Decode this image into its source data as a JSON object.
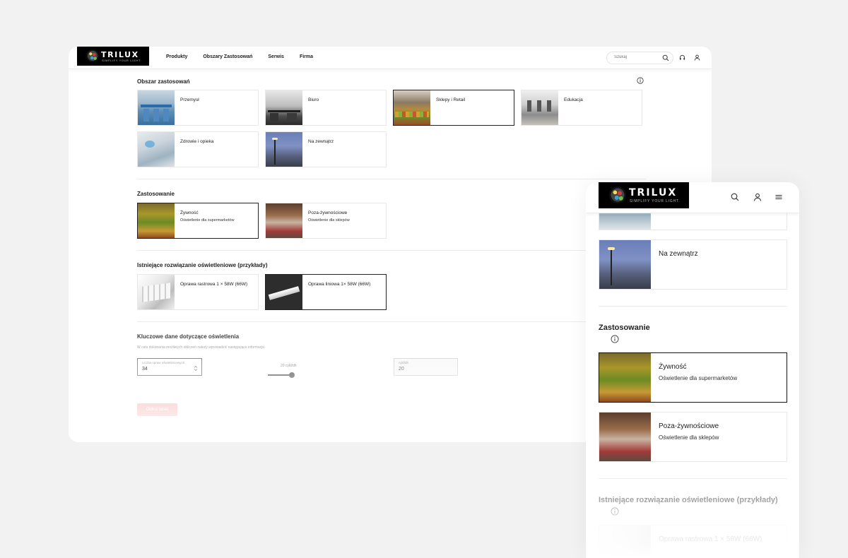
{
  "brand": {
    "name": "TRILUX",
    "tagline": "SIMPLIFY YOUR LIGHT."
  },
  "nav": {
    "items": [
      "Produkty",
      "Obszary Zastosowań",
      "Serwis",
      "Firma"
    ]
  },
  "search": {
    "placeholder": "Szukaj"
  },
  "sections": {
    "areas": {
      "title": "Obszar zastosowań",
      "items": [
        {
          "label": "Przemysł",
          "selected": false
        },
        {
          "label": "Biuro",
          "selected": false
        },
        {
          "label": "Sklepy i Retail",
          "selected": true
        },
        {
          "label": "Edukacja",
          "selected": false
        },
        {
          "label": "Zdrowie i opieka",
          "selected": false
        },
        {
          "label": "Na zewnątrz",
          "selected": false
        }
      ]
    },
    "application": {
      "title": "Zastosowanie",
      "items": [
        {
          "label": "Żywność",
          "sub": "Oświetlenie dla supermarketów",
          "selected": true
        },
        {
          "label": "Poza-żywnościowe",
          "sub": "Oświetlenie dla sklepów",
          "selected": false
        }
      ]
    },
    "existing": {
      "title": "Istniejące rozwiązanie oświetleniowe (przykłady)",
      "items": [
        {
          "label": "Oprawa rastrowa 1 × 58W (66W)",
          "selected": false
        },
        {
          "label": "Oprawa liniowa 1× 58W (66W)",
          "selected": true
        }
      ]
    },
    "keydata": {
      "title": "Kluczowe dane dotyczące oświetlenia",
      "subtitle": "W celu dokonania możliwych obliczeń należy wprowadzić następujące informacje.",
      "fixtures_label": "Liczba opraw oświetleniowych",
      "fixtures_value": "34",
      "slider_label": "20 cykl/dh",
      "slider_fraction": 0.83,
      "hours_label": "cykl/dh",
      "hours_value": "20",
      "button": "Oblicz teraz"
    }
  },
  "mobile": {
    "partial_item": "",
    "outdoor": "Na zewnątrz",
    "application_title": "Zastosowanie",
    "food": {
      "label": "Żywność",
      "sub": "Oświetlenie dla supermarketów"
    },
    "nonfood": {
      "label": "Poza-żywnościowe",
      "sub": "Oświetlenie dla sklepów"
    },
    "existing_title": "Istniejące rozwiązanie oświetleniowe (przykłady)",
    "existing_first": "Oprawa rastrowa 1 × 58W (66W)"
  },
  "colors": {
    "accent": "#f4b7b7",
    "selected_border": "#222222"
  },
  "icons": [
    "search-icon",
    "headset-icon",
    "user-icon",
    "info-icon",
    "menu-icon"
  ]
}
